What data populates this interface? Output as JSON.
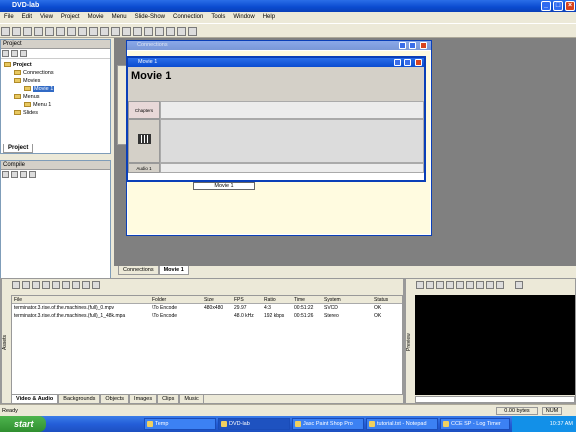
{
  "app": {
    "title": "DVD-lab"
  },
  "menu": [
    "File",
    "Edit",
    "View",
    "Project",
    "Movie",
    "Menu",
    "Slide-Show",
    "Connection",
    "Tools",
    "Window",
    "Help"
  ],
  "project_panel": {
    "title": "Project",
    "tree": [
      {
        "label": "Project",
        "level": 0
      },
      {
        "label": "Connections",
        "level": 1
      },
      {
        "label": "Movies",
        "level": 1
      },
      {
        "label": "Movie 1",
        "level": 2,
        "selected": true
      },
      {
        "label": "Menus",
        "level": 1
      },
      {
        "label": "Menu 1",
        "level": 2
      },
      {
        "label": "Slides",
        "level": 1
      }
    ],
    "tab": "Project"
  },
  "compile_panel": {
    "title": "Compile"
  },
  "connections_window": {
    "title": "Connections",
    "node_label": "Movie 1"
  },
  "movie_window": {
    "title": "Movie 1",
    "heading": "Movie 1",
    "tracks": {
      "chapters": "Chapters",
      "audio": "Audio 1"
    }
  },
  "doc_tabs": [
    "Connections",
    "Movie 1"
  ],
  "assets": {
    "columns": [
      "File",
      "Folder",
      "Size",
      "FPS",
      "Ratio",
      "Time",
      "System",
      "Status"
    ],
    "rows": [
      [
        "terminator.3.rise.of.the.machines.(full)_0.mpv",
        "\\To Encode",
        "480x480",
        "29.97",
        "4:3",
        "00:51:22",
        "SVCD",
        "OK"
      ],
      [
        "terminator.3.rise.of.the.machines.(full)_1_48k.mpa",
        "\\To Encode",
        "",
        "48.0 kHz",
        "192 kbps",
        "00:51:26",
        "Stereo",
        "OK"
      ]
    ],
    "tabs": [
      "Video & Audio",
      "Backgrounds",
      "Objects",
      "Images",
      "Clips",
      "Music"
    ],
    "side_label": "Assets"
  },
  "preview": {
    "side_label": "Preview"
  },
  "status": {
    "left": "Ready",
    "size": "0.00 bytes",
    "num": "NUM"
  },
  "taskbar": {
    "start": "start",
    "tasks": [
      "Temp",
      "DVD-lab",
      "Jasc Paint Shop Pro",
      "tutorial.txt - Notepad",
      "CCE SP - Log Timer"
    ],
    "clock": "10:37 AM"
  }
}
